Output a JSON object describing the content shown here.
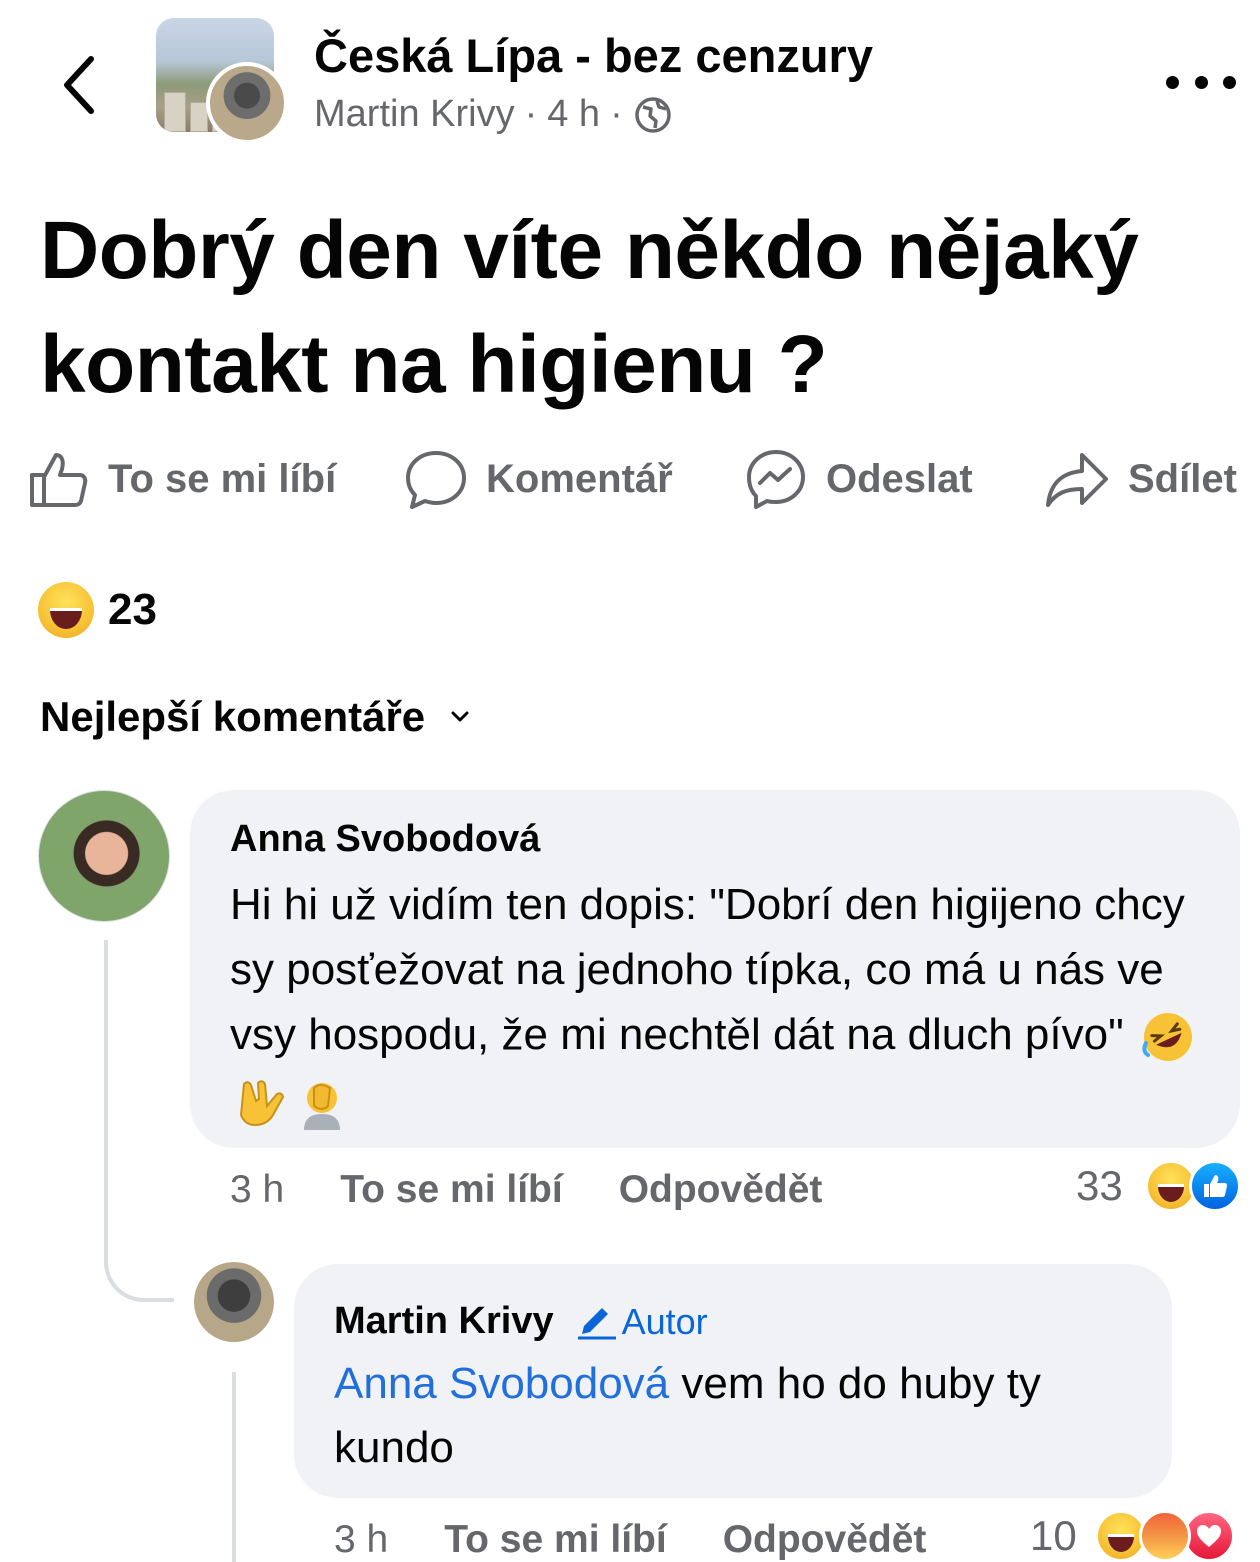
{
  "header": {
    "group_name": "Česká Lípa - bez cenzury",
    "author": "Martin Krivy",
    "time": "4 h",
    "separator": "·"
  },
  "post": {
    "text": "Dobrý den víte někdo nějaký kontakt na higienu ?"
  },
  "actions": {
    "like": "To se mi líbí",
    "comment": "Komentář",
    "send": "Odeslat",
    "share": "Sdílet"
  },
  "reactions": {
    "count": "23",
    "types": [
      "haha"
    ]
  },
  "comments_sort": {
    "label": "Nejlepší komentáře"
  },
  "comments": [
    {
      "author": "Anna Svobodová",
      "text": "Hi hi už vidím ten dopis: \"Dobrí den higijeno chcy sy posťežovat na jednoho típka, co má u nás ve vsy hospodu, že mi nechtěl dát na dluch pívo\"",
      "emojis": [
        "🤣",
        "🤟",
        "🤦"
      ],
      "time": "3 h",
      "like_label": "To se mi líbí",
      "reply_label": "Odpovědět",
      "reaction_count": "33",
      "reaction_types": [
        "haha",
        "like"
      ]
    },
    {
      "author": "Martin Krivy",
      "badge": "Autor",
      "mention": "Anna Svobodová",
      "text": "vem ho do huby ty kundo",
      "time": "3 h",
      "like_label": "To se mi líbí",
      "reply_label": "Odpovědět",
      "reaction_count": "10",
      "reaction_types": [
        "haha",
        "angry",
        "love"
      ]
    }
  ],
  "colors": {
    "secondary_text": "#65676b",
    "bubble": "#f0f2f5",
    "link": "#216fdb",
    "author_badge": "#0a66d8"
  }
}
